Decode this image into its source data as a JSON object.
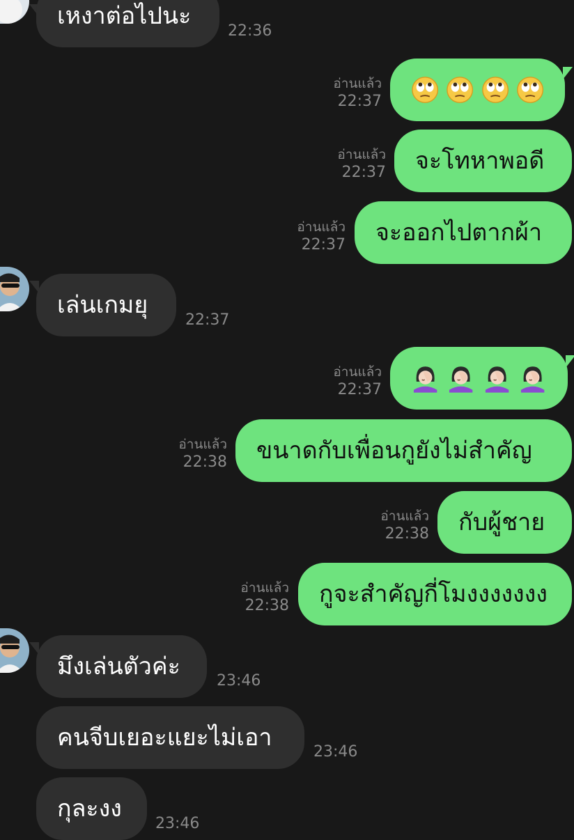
{
  "chat": {
    "colors": {
      "background": "#181818",
      "incoming_bubble": "#2f2f2f",
      "outgoing_bubble": "#6ee37e",
      "meta_text": "#8a8a8a"
    },
    "messages": [
      {
        "direction": "in",
        "text": "เหงาต่อไปนะ",
        "time": "22:36"
      },
      {
        "direction": "out",
        "emoji": "face-with-rolling-eyes",
        "count": 4,
        "read_label": "อ่านแล้ว",
        "time": "22:37"
      },
      {
        "direction": "out",
        "text": "จะโทหาพอดี",
        "read_label": "อ่านแล้ว",
        "time": "22:37"
      },
      {
        "direction": "out",
        "text": "จะออกไปตากผ้า",
        "read_label": "อ่านแล้ว",
        "time": "22:37"
      },
      {
        "direction": "in",
        "text": "เล่นเกมยุ",
        "time": "22:37"
      },
      {
        "direction": "out",
        "emoji": "woman-facepalming",
        "count": 4,
        "read_label": "อ่านแล้ว",
        "time": "22:37"
      },
      {
        "direction": "out",
        "text": "ขนาดกับเพื่อนกูยังไม่สำคัญ",
        "read_label": "อ่านแล้ว",
        "time": "22:38"
      },
      {
        "direction": "out",
        "text": "กับผู้ชาย",
        "read_label": "อ่านแล้ว",
        "time": "22:38"
      },
      {
        "direction": "out",
        "text": "กูจะสำคัญกี่โมงงงงงงง",
        "read_label": "อ่านแล้ว",
        "time": "22:38"
      },
      {
        "direction": "in",
        "text": "มึงเล่นตัวค่ะ",
        "time": "23:46"
      },
      {
        "direction": "in",
        "text": "คนจีบเยอะแยะไม่เอา",
        "time": "23:46"
      },
      {
        "direction": "in",
        "text": "กุละงง",
        "time": "23:46"
      }
    ]
  }
}
